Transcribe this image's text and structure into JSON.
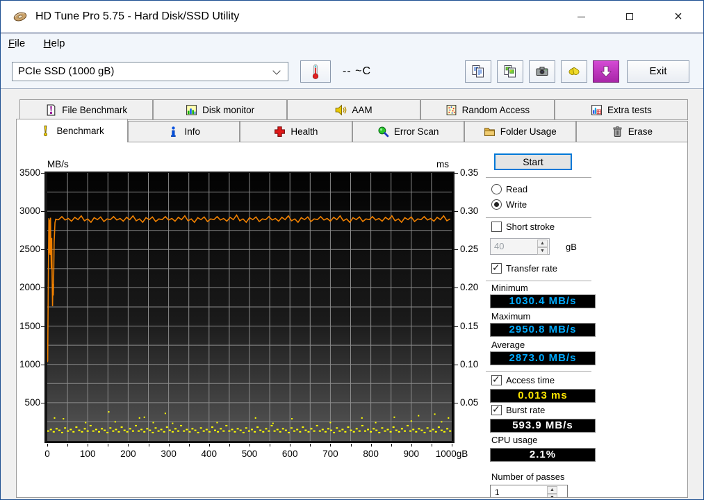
{
  "window": {
    "title": "HD Tune Pro 5.75 - Hard Disk/SSD Utility"
  },
  "menu": {
    "items": [
      {
        "label": "File"
      },
      {
        "label": "Help"
      }
    ]
  },
  "toolbar": {
    "drive_select": "PCIe SSD (1000 gB)",
    "temperature": "-- ~C",
    "exit_label": "Exit"
  },
  "icons": {
    "check": "✓",
    "spin_up": "▲",
    "spin_down": "▼",
    "close": "×",
    "download_arrow": "↓"
  },
  "tabs": {
    "active": "Benchmark",
    "row1": [
      {
        "label": "File Benchmark"
      },
      {
        "label": "Disk monitor"
      },
      {
        "label": "AAM"
      },
      {
        "label": "Random Access"
      },
      {
        "label": "Extra tests"
      }
    ],
    "row2": [
      {
        "label": "Benchmark"
      },
      {
        "label": "Info"
      },
      {
        "label": "Health"
      },
      {
        "label": "Error Scan"
      },
      {
        "label": "Folder Usage"
      },
      {
        "label": "Erase"
      }
    ]
  },
  "controls": {
    "start_label": "Start",
    "read_label": "Read",
    "write_label": "Write",
    "write_selected": true,
    "short_stroke_label": "Short stroke",
    "short_stroke_checked": false,
    "short_stroke_value": "40",
    "short_stroke_unit": "gB",
    "transfer_rate_label": "Transfer rate",
    "transfer_rate_checked": true,
    "minimum_label": "Minimum",
    "minimum_value": "1030.4 MB/s",
    "maximum_label": "Maximum",
    "maximum_value": "2950.8 MB/s",
    "average_label": "Average",
    "average_value": "2873.0 MB/s",
    "access_time_label": "Access time",
    "access_time_value": "0.013 ms",
    "access_time_checked": true,
    "burst_rate_label": "Burst rate",
    "burst_rate_value": "593.9 MB/s",
    "burst_rate_checked": true,
    "cpu_usage_label": "CPU usage",
    "cpu_usage_value": "2.1%",
    "passes_label": "Number of passes",
    "passes_value": "1"
  },
  "colors": {
    "accent": "#0078d7",
    "transfer_line": "#f08000",
    "access_dots": "#ffff00",
    "lcd_cyan": "#00aaff",
    "lcd_yellow": "#ffe600",
    "lcd_white": "#ffffff",
    "download_button": "#c03cc0"
  },
  "chart_data": {
    "type": "line",
    "title": "",
    "x_axis": {
      "min": 0,
      "max": 1000,
      "grid_step": 50,
      "tick_step": 100,
      "tick_labels": [
        "0",
        "100",
        "200",
        "300",
        "400",
        "500",
        "600",
        "700",
        "800",
        "900",
        "1000gB"
      ]
    },
    "y_left": {
      "unit": "MB/s",
      "min": 0,
      "max": 3500,
      "grid_step": 250,
      "ticks": [
        "3500",
        "3000",
        "2500",
        "2000",
        "1500",
        "1000",
        "500"
      ]
    },
    "y_right": {
      "unit": "ms",
      "min": 0,
      "max": 0.35,
      "ticks": [
        "0.35",
        "0.30",
        "0.25",
        "0.20",
        "0.15",
        "0.10",
        "0.05"
      ]
    },
    "transfer_rate": {
      "name": "Transfer rate",
      "unit": "MB/s",
      "color": "#f08000",
      "transient_points": [
        [
          0,
          1030
        ],
        [
          1,
          1045
        ],
        [
          3,
          2300
        ],
        [
          4,
          2910
        ],
        [
          5,
          2450
        ],
        [
          6,
          2890
        ],
        [
          7,
          2430
        ],
        [
          8,
          2915
        ],
        [
          9,
          2520
        ],
        [
          10,
          2250
        ],
        [
          11,
          2650
        ],
        [
          12,
          2150
        ],
        [
          13,
          1760
        ],
        [
          14,
          2050
        ],
        [
          15,
          1900
        ],
        [
          16,
          2200
        ],
        [
          17,
          2600
        ],
        [
          19,
          2850
        ],
        [
          21,
          2895
        ],
        [
          24,
          2890
        ]
      ],
      "steady_x_start": 28,
      "steady_x_step": 8,
      "steady_values": [
        2890,
        2930,
        2885,
        2905,
        2870,
        2920,
        2890,
        2940,
        2875,
        2900,
        2855,
        2915,
        2890,
        2925,
        2865,
        2900,
        2890,
        2930,
        2885,
        2905,
        2870,
        2920,
        2890,
        2940,
        2875,
        2900,
        2855,
        2915,
        2890,
        2925,
        2865,
        2900,
        2890,
        2930,
        2885,
        2905,
        2870,
        2920,
        2890,
        2940,
        2875,
        2900,
        2855,
        2915,
        2890,
        2925,
        2865,
        2900,
        2890,
        2930,
        2885,
        2905,
        2870,
        2920,
        2890,
        2950,
        2875,
        2900,
        2855,
        2915,
        2890,
        2925,
        2865,
        2900,
        2890,
        2930,
        2885,
        2905,
        2870,
        2920,
        2890,
        2940,
        2875,
        2900,
        2855,
        2915,
        2890,
        2925,
        2865,
        2900,
        2890,
        2930,
        2885,
        2905,
        2870,
        2920,
        2890,
        2940,
        2875,
        2900,
        2855,
        2915,
        2890,
        2925,
        2865,
        2900,
        2890,
        2930,
        2885,
        2905,
        2870,
        2920,
        2890,
        2940,
        2875,
        2900,
        2855,
        2915,
        2890,
        2925,
        2865,
        2900,
        2890,
        2930,
        2885,
        2905,
        2870,
        2920,
        2890,
        2940,
        2875,
        2900,
        2855,
        2915,
        2890,
        2925,
        2865,
        2900
      ]
    },
    "access_time": {
      "name": "Access time",
      "unit": "ms",
      "color": "#ffff00",
      "band_x_start": 2,
      "band_x_step": 7,
      "band_ms": [
        0.013,
        0.015,
        0.012,
        0.016,
        0.014,
        0.011,
        0.017,
        0.013,
        0.015,
        0.012,
        0.018,
        0.014,
        0.012,
        0.016,
        0.013,
        0.02,
        0.013,
        0.015,
        0.012,
        0.016,
        0.014,
        0.011,
        0.017,
        0.013,
        0.015,
        0.012,
        0.018,
        0.014,
        0.012,
        0.016,
        0.013,
        0.02,
        0.013,
        0.015,
        0.012,
        0.016,
        0.014,
        0.011,
        0.017,
        0.013,
        0.015,
        0.012,
        0.018,
        0.014,
        0.012,
        0.016,
        0.013,
        0.02,
        0.013,
        0.015,
        0.012,
        0.016,
        0.014,
        0.011,
        0.017,
        0.013,
        0.015,
        0.012,
        0.018,
        0.014,
        0.012,
        0.016,
        0.013,
        0.02,
        0.013,
        0.015,
        0.012,
        0.016,
        0.014,
        0.011,
        0.017,
        0.013,
        0.015,
        0.012,
        0.018,
        0.014,
        0.012,
        0.016,
        0.013,
        0.02,
        0.013,
        0.015,
        0.012,
        0.016,
        0.014,
        0.011,
        0.017,
        0.013,
        0.015,
        0.012,
        0.018,
        0.014,
        0.012,
        0.016,
        0.013,
        0.02,
        0.013,
        0.015,
        0.012,
        0.016,
        0.014,
        0.011,
        0.017,
        0.013,
        0.015,
        0.012,
        0.018,
        0.014,
        0.012,
        0.016,
        0.013,
        0.02,
        0.013,
        0.015,
        0.012,
        0.016,
        0.014,
        0.011,
        0.017,
        0.013,
        0.015,
        0.012,
        0.018,
        0.014,
        0.012,
        0.016,
        0.013,
        0.02,
        0.013,
        0.015,
        0.012,
        0.016,
        0.014,
        0.011,
        0.017,
        0.013,
        0.015,
        0.012,
        0.018,
        0.014,
        0.012,
        0.016,
        0.013,
        0.02
      ],
      "outlier_points": [
        [
          18,
          0.03
        ],
        [
          40,
          0.029
        ],
        [
          95,
          0.024
        ],
        [
          152,
          0.038
        ],
        [
          168,
          0.025
        ],
        [
          228,
          0.03
        ],
        [
          240,
          0.031
        ],
        [
          262,
          0.024
        ],
        [
          292,
          0.036
        ],
        [
          310,
          0.023
        ],
        [
          420,
          0.024
        ],
        [
          515,
          0.03
        ],
        [
          558,
          0.023
        ],
        [
          605,
          0.029
        ],
        [
          700,
          0.024
        ],
        [
          778,
          0.03
        ],
        [
          812,
          0.024
        ],
        [
          858,
          0.031
        ],
        [
          900,
          0.026
        ],
        [
          918,
          0.033
        ],
        [
          958,
          0.035
        ],
        [
          975,
          0.025
        ],
        [
          992,
          0.03
        ]
      ]
    },
    "stats": {
      "minimum_mbs": 1030.4,
      "maximum_mbs": 2950.8,
      "average_mbs": 2873.0,
      "access_time_ms": 0.013,
      "burst_rate_mbs": 593.9,
      "cpu_usage_pct": 2.1
    }
  }
}
